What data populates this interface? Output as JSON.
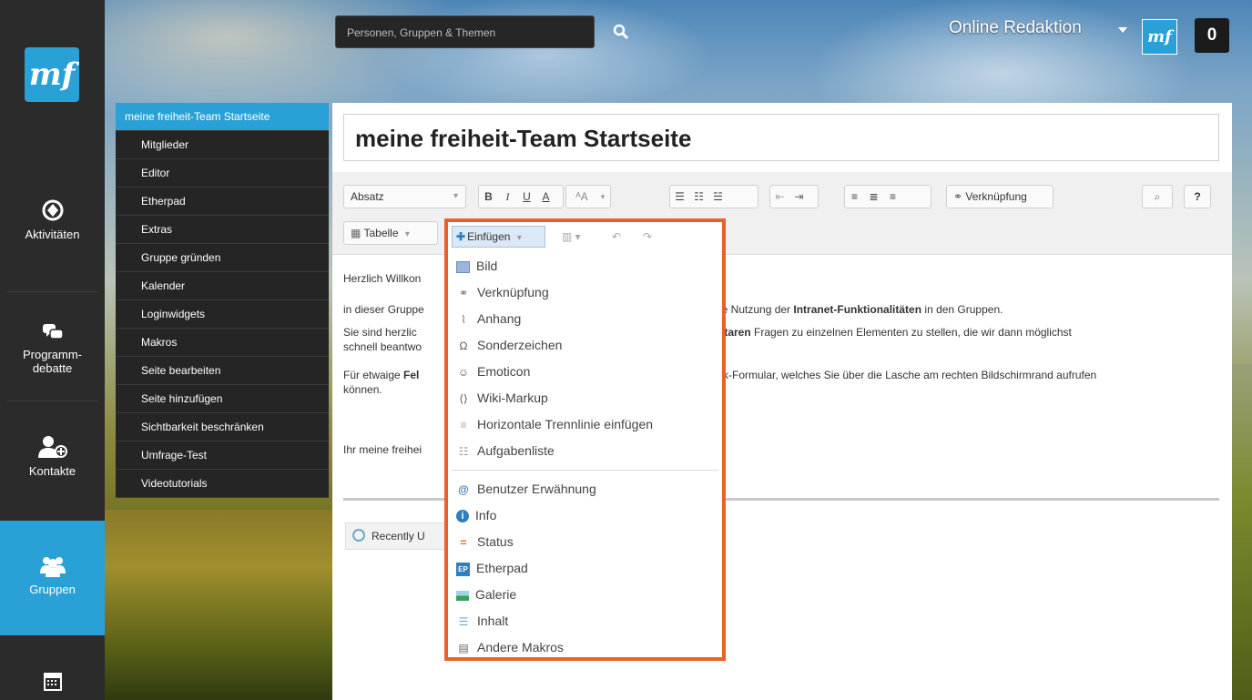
{
  "leftnav": {
    "logo": "mf",
    "items": [
      {
        "label": "Aktivitäten",
        "icon": "activity-icon"
      },
      {
        "label": "Programm-\ndebatte",
        "icon": "chat-bubbles-icon"
      },
      {
        "label": "Kontakte",
        "icon": "add-contact-icon"
      },
      {
        "label": "Gruppen",
        "icon": "groups-icon"
      },
      {
        "label": "",
        "icon": "calendar-icon"
      }
    ]
  },
  "header": {
    "search_placeholder": "Personen, Gruppen & Themen",
    "user_name": "Online Redaktion",
    "avatar_text": "mf",
    "notification_count": "0"
  },
  "pagemenu": {
    "items": [
      "meine freiheit-Team Startseite",
      "Mitglieder",
      "Editor",
      "Etherpad",
      "Extras",
      "Gruppe gründen",
      "Kalender",
      "Loginwidgets",
      "Makros",
      "Seite bearbeiten",
      "Seite hinzufügen",
      "Sichtbarkeit beschränken",
      "Umfrage-Test",
      "Videotutorials"
    ]
  },
  "editor": {
    "title": "meine freiheit-Team Startseite",
    "toolbar": {
      "paragraph_style": "Absatz",
      "bold": "B",
      "italic": "I",
      "underline": "U",
      "font_color": "A",
      "font_size": "ᴬA",
      "link_button": "Verknüpfung",
      "find_button": "🔍",
      "help_button": "?",
      "table_button": "Tabelle",
      "insert_button": "Einfügen"
    },
    "body": {
      "p1": "Herzlich Willkon",
      "p2a": "in dieser Gruppe",
      "p2b": "ie Nutzung der ",
      "p2c": "Intranet-Funktionalitäten",
      "p2d": " in den Gruppen.",
      "p3a": "Sie sind herzlic",
      "p3b": "ntaren",
      "p3c": " Fragen zu einzelnen Elementen zu stellen, die wir dann möglichst",
      "p3d": "schnell beantwo",
      "p4a": "Für etwaige ",
      "p4b": "Fel",
      "p4c": "ck-Formular, welches Sie über die Lasche am rechten Bildschirmrand aufrufen",
      "p4d": "können.",
      "p5": "Ihr meine freihei"
    },
    "recently_button": "Recently U"
  },
  "insert_menu": {
    "group1": [
      {
        "label": "Bild",
        "icon": "image-icon",
        "color": "#6b8fb8"
      },
      {
        "label": "Verknüpfung",
        "icon": "link-icon",
        "color": "#777777"
      },
      {
        "label": "Anhang",
        "icon": "paperclip-icon",
        "color": "#777777"
      },
      {
        "label": "Sonderzeichen",
        "icon": "omega-icon",
        "color": "#777777"
      },
      {
        "label": "Emoticon",
        "icon": "smiley-icon",
        "color": "#777777"
      },
      {
        "label": "Wiki-Markup",
        "icon": "code-icon",
        "color": "#777777"
      },
      {
        "label": "Horizontale Trennlinie einfügen",
        "icon": "horizontal-rule-icon",
        "color": "#999999"
      },
      {
        "label": "Aufgabenliste",
        "icon": "tasklist-icon",
        "color": "#999999"
      }
    ],
    "group2": [
      {
        "label": "Benutzer Erwähnung",
        "icon": "at-icon",
        "color": "#2e7fbf"
      },
      {
        "label": "Info",
        "icon": "info-icon",
        "color": "#2e7fbf"
      },
      {
        "label": "Status",
        "icon": "status-icon",
        "color": "#e6622a"
      },
      {
        "label": "Etherpad",
        "icon": "etherpad-icon",
        "color": "#2e7fbf"
      },
      {
        "label": "Galerie",
        "icon": "gallery-icon",
        "color": "#3a9f5a"
      },
      {
        "label": "Inhalt",
        "icon": "toc-icon",
        "color": "#6fa6cf"
      },
      {
        "label": "Andere Makros",
        "icon": "macros-icon",
        "color": "#777777"
      }
    ]
  },
  "colors": {
    "accent": "#2aa1d6",
    "highlight_border": "#e6622a"
  }
}
